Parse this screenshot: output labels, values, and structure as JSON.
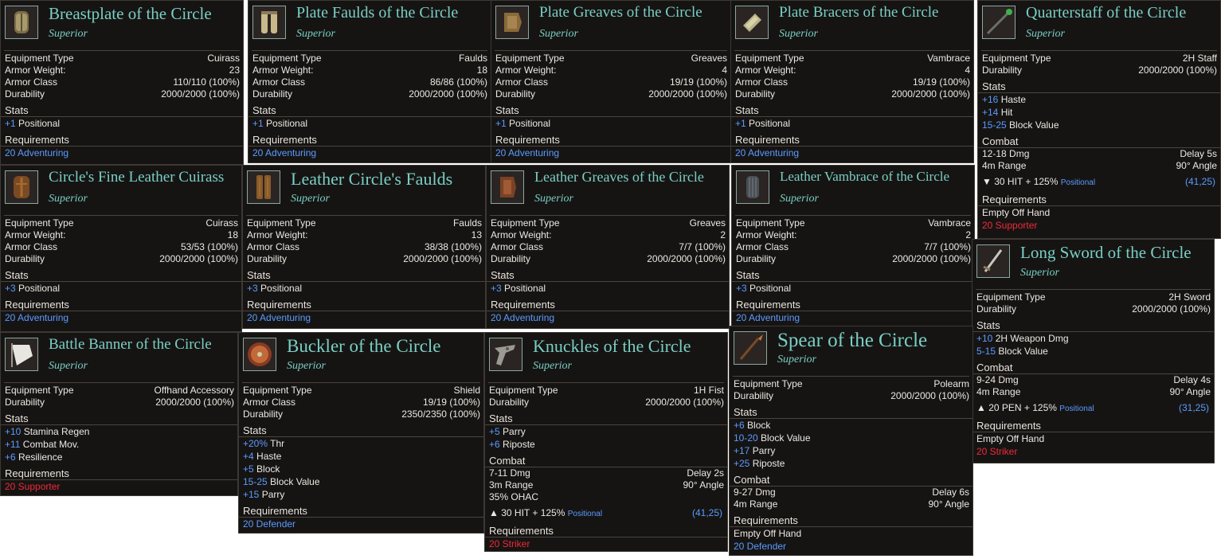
{
  "colors": {
    "panel_bg": "#161413",
    "title": "#79cfc4",
    "stat_blue": "#5b9bff",
    "req_red": "#ee2a3a",
    "req_blue": "#5b9bff"
  },
  "labels": {
    "equipment_type": "Equipment Type",
    "armor_weight": "Armor Weight:",
    "armor_class": "Armor Class",
    "durability": "Durability",
    "stats": "Stats",
    "requirements": "Requirements",
    "combat": "Combat",
    "positional": "Positional"
  },
  "tooltips": [
    {
      "id": "breastplate",
      "name": "Breastplate of the Circle",
      "rarity": "Superior",
      "icon": "breastplate-icon",
      "type": "Cuirass",
      "weight": "23",
      "armor_class": "110/110 (100%)",
      "durability": "2000/2000 (100%)",
      "stats": [
        {
          "value": "+1",
          "label": "Positional"
        }
      ],
      "requirements": [
        {
          "text": "20 Adventuring",
          "color": "blue"
        }
      ]
    },
    {
      "id": "faulds",
      "name": "Plate Faulds of the Circle",
      "rarity": "Superior",
      "icon": "faulds-icon",
      "type": "Faulds",
      "weight": "18",
      "armor_class": "86/86 (100%)",
      "durability": "2000/2000 (100%)",
      "stats": [
        {
          "value": "+1",
          "label": "Positional"
        }
      ],
      "requirements": [
        {
          "text": "20 Adventuring",
          "color": "blue"
        }
      ]
    },
    {
      "id": "greaves",
      "name": "Plate Greaves of the Circle",
      "rarity": "Superior",
      "icon": "greaves-icon",
      "type": "Greaves",
      "weight": "4",
      "armor_class": "19/19 (100%)",
      "durability": "2000/2000 (100%)",
      "stats": [
        {
          "value": "+1",
          "label": "Positional"
        }
      ],
      "requirements": [
        {
          "text": "20 Adventuring",
          "color": "blue"
        }
      ]
    },
    {
      "id": "bracers",
      "name": "Plate Bracers of the Circle",
      "rarity": "Superior",
      "icon": "bracers-icon",
      "type": "Vambrace",
      "weight": "4",
      "armor_class": "19/19 (100%)",
      "durability": "2000/2000 (100%)",
      "stats": [
        {
          "value": "+1",
          "label": "Positional"
        }
      ],
      "requirements": [
        {
          "text": "20 Adventuring",
          "color": "blue"
        }
      ]
    },
    {
      "id": "quarterstaff",
      "name": "Quarterstaff of the Circle",
      "rarity": "Superior",
      "icon": "quarterstaff-icon",
      "type": "2H Staff",
      "durability": "2000/2000 (100%)",
      "stats": [
        {
          "value": "+16",
          "label": "Haste"
        },
        {
          "value": "+14",
          "label": "Hit"
        },
        {
          "value": "15-25",
          "label": "Block Value"
        }
      ],
      "combat": {
        "dmg": "12-18 Dmg",
        "delay": "Delay 5s",
        "range": "4m Range",
        "angle": "90° Angle"
      },
      "hit": {
        "text": "30 HIT + 125%",
        "tag": "Positional",
        "num": "(41,25)",
        "icon": "chevron-down-icon"
      },
      "requirements": [
        {
          "text": "Empty Off Hand",
          "color": "white"
        },
        {
          "text": "20 Supporter",
          "color": "red"
        }
      ]
    },
    {
      "id": "leather-cuirass",
      "name": "Circle's Fine Leather Cuirass",
      "rarity": "Superior",
      "icon": "leather-cuirass-icon",
      "type": "Cuirass",
      "weight": "18",
      "armor_class": "53/53 (100%)",
      "durability": "2000/2000 (100%)",
      "stats": [
        {
          "value": "+3",
          "label": "Positional"
        }
      ],
      "requirements": [
        {
          "text": "20 Adventuring",
          "color": "blue"
        }
      ]
    },
    {
      "id": "leather-faulds",
      "name": "Leather Circle's Faulds",
      "rarity": "Superior",
      "icon": "leather-faulds-icon",
      "type": "Faulds",
      "weight": "13",
      "armor_class": "38/38 (100%)",
      "durability": "2000/2000 (100%)",
      "stats": [
        {
          "value": "+3",
          "label": "Positional"
        }
      ],
      "requirements": [
        {
          "text": "20 Adventuring",
          "color": "blue"
        }
      ]
    },
    {
      "id": "leather-greaves",
      "name": "Leather Greaves of the Circle",
      "rarity": "Superior",
      "icon": "leather-greaves-icon",
      "type": "Greaves",
      "weight": "2",
      "armor_class": "7/7 (100%)",
      "durability": "2000/2000 (100%)",
      "stats": [
        {
          "value": "+3",
          "label": "Positional"
        }
      ],
      "requirements": [
        {
          "text": "20 Adventuring",
          "color": "blue"
        }
      ]
    },
    {
      "id": "leather-vambrace",
      "name": "Leather Vambrace of the Circle",
      "rarity": "Superior",
      "icon": "leather-vambrace-icon",
      "type": "Vambrace",
      "weight": "2",
      "armor_class": "7/7 (100%)",
      "durability": "2000/2000 (100%)",
      "stats": [
        {
          "value": "+3",
          "label": "Positional"
        }
      ],
      "requirements": [
        {
          "text": "20 Adventuring",
          "color": "blue"
        }
      ]
    },
    {
      "id": "longsword",
      "name": "Long Sword of the Circle",
      "rarity": "Superior",
      "icon": "longsword-icon",
      "type": "2H Sword",
      "durability": "2000/2000 (100%)",
      "stats": [
        {
          "value": "+10",
          "label": "2H Weapon Dmg"
        },
        {
          "value": "5-15",
          "label": "Block Value"
        }
      ],
      "combat": {
        "dmg": "9-24 Dmg",
        "delay": "Delay 4s",
        "range": "4m Range",
        "angle": "90° Angle"
      },
      "hit": {
        "text": "20 PEN + 125%",
        "tag": "Positional",
        "num": "(31,25)",
        "icon": "chevron-up-icon"
      },
      "requirements": [
        {
          "text": "Empty Off Hand",
          "color": "white"
        },
        {
          "text": "20 Striker",
          "color": "red"
        }
      ]
    },
    {
      "id": "banner",
      "name": "Battle Banner of the Circle",
      "rarity": "Superior",
      "icon": "banner-icon",
      "type": "Offhand Accessory",
      "durability": "2000/2000 (100%)",
      "stats": [
        {
          "value": "+10",
          "label": "Stamina Regen"
        },
        {
          "value": "+11",
          "label": "Combat Mov."
        },
        {
          "value": "+6",
          "label": "Resilience"
        }
      ],
      "requirements": [
        {
          "text": "20 Supporter",
          "color": "red"
        }
      ]
    },
    {
      "id": "buckler",
      "name": "Buckler of the Circle",
      "rarity": "Superior",
      "icon": "buckler-icon",
      "type": "Shield",
      "armor_class": "19/19 (100%)",
      "durability": "2350/2350 (100%)",
      "stats": [
        {
          "value": "+20%",
          "label": "Thr"
        },
        {
          "value": "+4",
          "label": "Haste"
        },
        {
          "value": "+5",
          "label": "Block"
        },
        {
          "value": "15-25",
          "label": "Block Value"
        },
        {
          "value": "+15",
          "label": "Parry"
        }
      ],
      "requirements": [
        {
          "text": "20 Defender",
          "color": "blue"
        }
      ]
    },
    {
      "id": "knuckles",
      "name": "Knuckles of the Circle",
      "rarity": "Superior",
      "icon": "knuckles-icon",
      "type": "1H Fist",
      "durability": "2000/2000 (100%)",
      "stats": [
        {
          "value": "+5",
          "label": "Parry"
        },
        {
          "value": "+6",
          "label": "Riposte"
        }
      ],
      "combat": {
        "dmg": "7-11 Dmg",
        "delay": "Delay 2s",
        "range": "3m Range",
        "angle": "90° Angle",
        "extra": "35% OHAC"
      },
      "hit": {
        "text": "30 HIT + 125%",
        "tag": "Positional",
        "num": "(41,25)",
        "icon": "chevron-up-icon"
      },
      "requirements": [
        {
          "text": "20 Striker",
          "color": "red"
        }
      ]
    },
    {
      "id": "spear",
      "name": "Spear of the Circle",
      "rarity": "Superior",
      "icon": "spear-icon",
      "type": "Polearm",
      "durability": "2000/2000 (100%)",
      "stats": [
        {
          "value": "+6",
          "label": "Block"
        },
        {
          "value": "10-20",
          "label": "Block Value"
        },
        {
          "value": "+17",
          "label": "Parry"
        },
        {
          "value": "+25",
          "label": "Riposte"
        }
      ],
      "combat": {
        "dmg": "9-27 Dmg",
        "delay": "Delay 6s",
        "range": "4m Range",
        "angle": "90° Angle"
      },
      "requirements": [
        {
          "text": "Empty Off Hand",
          "color": "white"
        },
        {
          "text": "20 Defender",
          "color": "blue"
        }
      ]
    }
  ]
}
